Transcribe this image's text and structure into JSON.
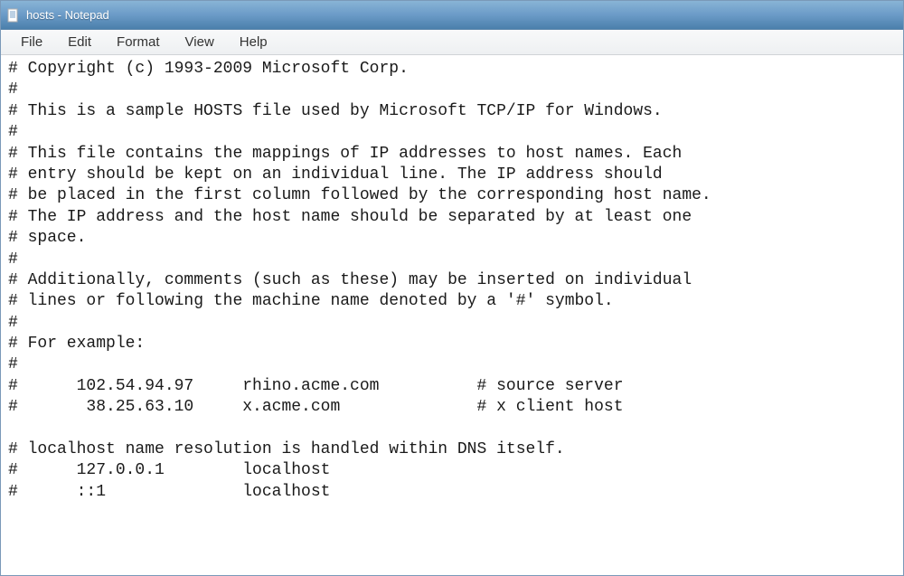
{
  "window": {
    "title": "hosts - Notepad"
  },
  "menubar": {
    "items": [
      {
        "label": "File"
      },
      {
        "label": "Edit"
      },
      {
        "label": "Format"
      },
      {
        "label": "View"
      },
      {
        "label": "Help"
      }
    ]
  },
  "editor": {
    "content": "# Copyright (c) 1993-2009 Microsoft Corp.\n#\n# This is a sample HOSTS file used by Microsoft TCP/IP for Windows.\n#\n# This file contains the mappings of IP addresses to host names. Each\n# entry should be kept on an individual line. The IP address should\n# be placed in the first column followed by the corresponding host name.\n# The IP address and the host name should be separated by at least one\n# space.\n#\n# Additionally, comments (such as these) may be inserted on individual\n# lines or following the machine name denoted by a '#' symbol.\n#\n# For example:\n#\n#      102.54.94.97     rhino.acme.com          # source server\n#       38.25.63.10     x.acme.com              # x client host\n\n# localhost name resolution is handled within DNS itself.\n#      127.0.0.1        localhost\n#      ::1              localhost\n"
  }
}
